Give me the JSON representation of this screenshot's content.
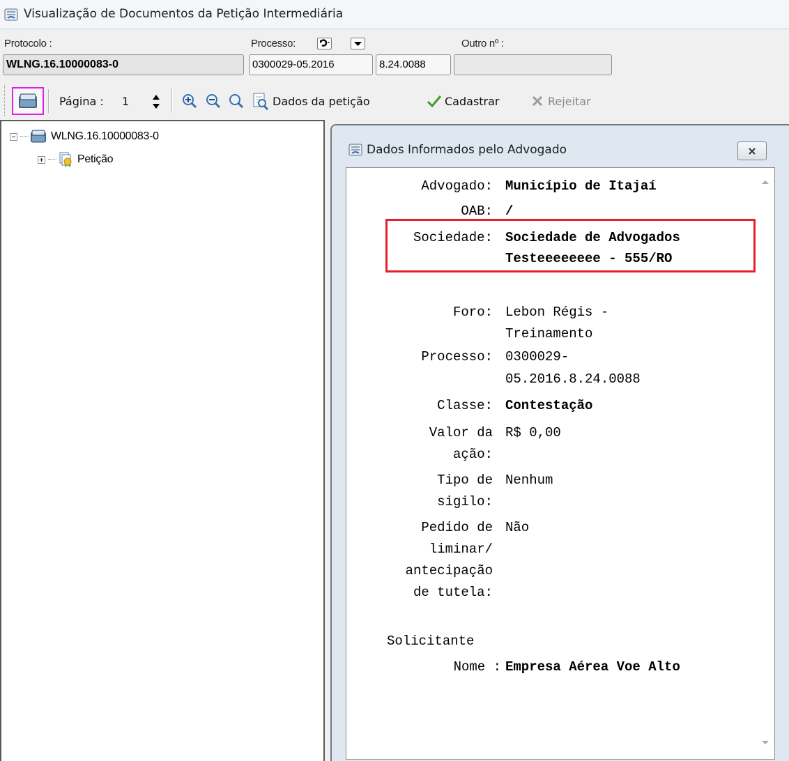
{
  "window": {
    "title": "Visualização de Documentos da Petição Intermediária"
  },
  "fields": {
    "protocolo_label": "Protocolo :",
    "protocolo_value": "WLNG.16.10000083-0",
    "processo_label": "Processo:",
    "processo_number": "0300029-05.2016",
    "processo_foro": "8.24.0088",
    "outro_label": "Outro nº :",
    "outro_value": ""
  },
  "toolbar": {
    "pagina_label": "Página :",
    "pagina_value": "1",
    "dados_label": "Dados da petição",
    "cadastrar_label": "Cadastrar",
    "rejeitar_label": "Rejeitar"
  },
  "tree": {
    "root_label": "WLNG.16.10000083-0",
    "child_label": "Petição"
  },
  "dialog": {
    "title": "Dados Informados pelo Advogado",
    "rows": [
      {
        "key": "Advogado:",
        "value": "Município de Itajaí"
      },
      {
        "key": "OAB:",
        "value": "/"
      },
      {
        "key": "Sociedade:",
        "value_lines": [
          "Sociedade de Advogados",
          "Testeeeeeeee - 555/RO"
        ]
      },
      {
        "key": "Foro:",
        "value_lines": [
          "Lebon Régis -",
          "Treinamento"
        ]
      },
      {
        "key": "Processo:",
        "value_lines": [
          "0300029-",
          "05.2016.8.24.0088"
        ]
      },
      {
        "key": "Classe:",
        "value": "Contestação"
      },
      {
        "key_lines": [
          "Valor da",
          "ação:"
        ],
        "value": "R$ 0,00"
      },
      {
        "key_lines": [
          "Tipo de",
          "sigilo:"
        ],
        "value": "Nenhum"
      },
      {
        "key_lines": [
          "Pedido de",
          "liminar/",
          "antecipação",
          "de tutela:"
        ],
        "value": "Não"
      }
    ],
    "solicitante_heading": "Solicitante",
    "nome_key": "Nome :",
    "nome_value": "Empresa Aérea Voe Alto"
  },
  "colors": {
    "highlight": "#e4202a",
    "selected_border": "#e020e0"
  }
}
